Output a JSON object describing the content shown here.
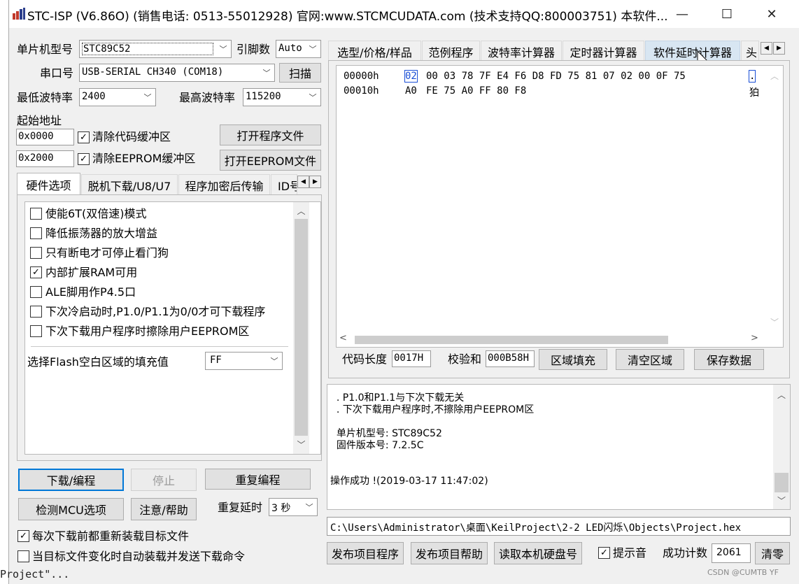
{
  "window": {
    "title": "STC-ISP (V6.86O) (销售电话: 0513-55012928) 官网:www.STCMCUDATA.com  (技术支持QQ:800003751) 本软件...",
    "minimize": "—",
    "maximize": "☐",
    "close": "✕"
  },
  "left": {
    "mcu_label": "单片机型号",
    "mcu_value": "STC89C52",
    "pins_label": "引脚数",
    "pins_value": "Auto",
    "port_label": "串口号",
    "port_value": "USB-SERIAL CH340 (COM18)",
    "scan_button": "扫描",
    "min_baud_label": "最低波特率",
    "min_baud_value": "2400",
    "max_baud_label": "最高波特率",
    "max_baud_value": "115200",
    "start_addr_label": "起始地址",
    "addr1_value": "0x0000",
    "clear_code_label": "清除代码缓冲区",
    "open_program_button": "打开程序文件",
    "addr2_value": "0x2000",
    "clear_eeprom_label": "清除EEPROM缓冲区",
    "open_eeprom_button": "打开EEPROM文件",
    "tabs": [
      "硬件选项",
      "脱机下载/U8/U7",
      "程序加密后传输",
      "ID号"
    ],
    "options": [
      {
        "label": "使能6T(双倍速)模式",
        "checked": false
      },
      {
        "label": "降低振荡器的放大增益",
        "checked": false
      },
      {
        "label": "只有断电才可停止看门狗",
        "checked": false
      },
      {
        "label": "内部扩展RAM可用",
        "checked": true
      },
      {
        "label": "ALE脚用作P4.5口",
        "checked": false
      },
      {
        "label": "下次冷启动时,P1.0/P1.1为0/0才可下载程序",
        "checked": false
      },
      {
        "label": "下次下载用户程序时擦除用户EEPROM区",
        "checked": false
      }
    ],
    "fill_label": "选择Flash空白区域的填充值",
    "fill_value": "FF",
    "download_button": "下载/编程",
    "stop_button": "停止",
    "reprogram_button": "重复编程",
    "detect_button": "检测MCU选项",
    "help_button": "注意/帮助",
    "delay_label": "重复延时",
    "delay_value": "3 秒",
    "reload_label": "每次下载前都重新装载目标文件",
    "reload_checked": true,
    "auto_label": "当目标文件变化时自动装载并发送下载命令",
    "auto_checked": false
  },
  "right": {
    "tabs": [
      "选型/价格/样品",
      "范例程序",
      "波特率计算器",
      "定时器计算器",
      "软件延时计算器",
      "头"
    ],
    "hex_lines": [
      {
        "addr": "00000h",
        "first": "02",
        "rest": "00 03 78 7F E4 F6 D8 FD 75 81 07 02 00 0F 75",
        "ascii": "."
      },
      {
        "addr": "00010h",
        "first": "A0",
        "rest": "FE 75 A0 FF 80 F8",
        "ascii": "狛"
      }
    ],
    "code_len_label": "代码长度",
    "code_len_value": "0017H",
    "checksum_label": "校验和",
    "checksum_value": "000B58H",
    "fill_region_button": "区域填充",
    "clear_region_button": "清空区域",
    "save_data_button": "保存数据",
    "log_lines": [
      "  . P1.0和P1.1与下次下载无关",
      "  . 下次下载用户程序时,不擦除用户EEPROM区",
      "",
      "  单片机型号: STC89C52",
      "  固件版本号: 7.2.5C",
      "",
      "",
      "操作成功 !(2019-03-17 11:47:02)"
    ],
    "path_value": "C:\\Users\\Administrator\\桌面\\KeilProject\\2-2 LED闪烁\\Objects\\Project.hex",
    "publish_program_button": "发布项目程序",
    "publish_help_button": "发布项目帮助",
    "read_disk_button": "读取本机硬盘号",
    "beep_label": "提示音",
    "beep_checked": true,
    "success_label": "成功计数",
    "success_value": "2061",
    "reset_button": "清零"
  },
  "background": {
    "left_edge_text": "Project\"...",
    "watermark": "CSDN @CUMTB YF"
  }
}
